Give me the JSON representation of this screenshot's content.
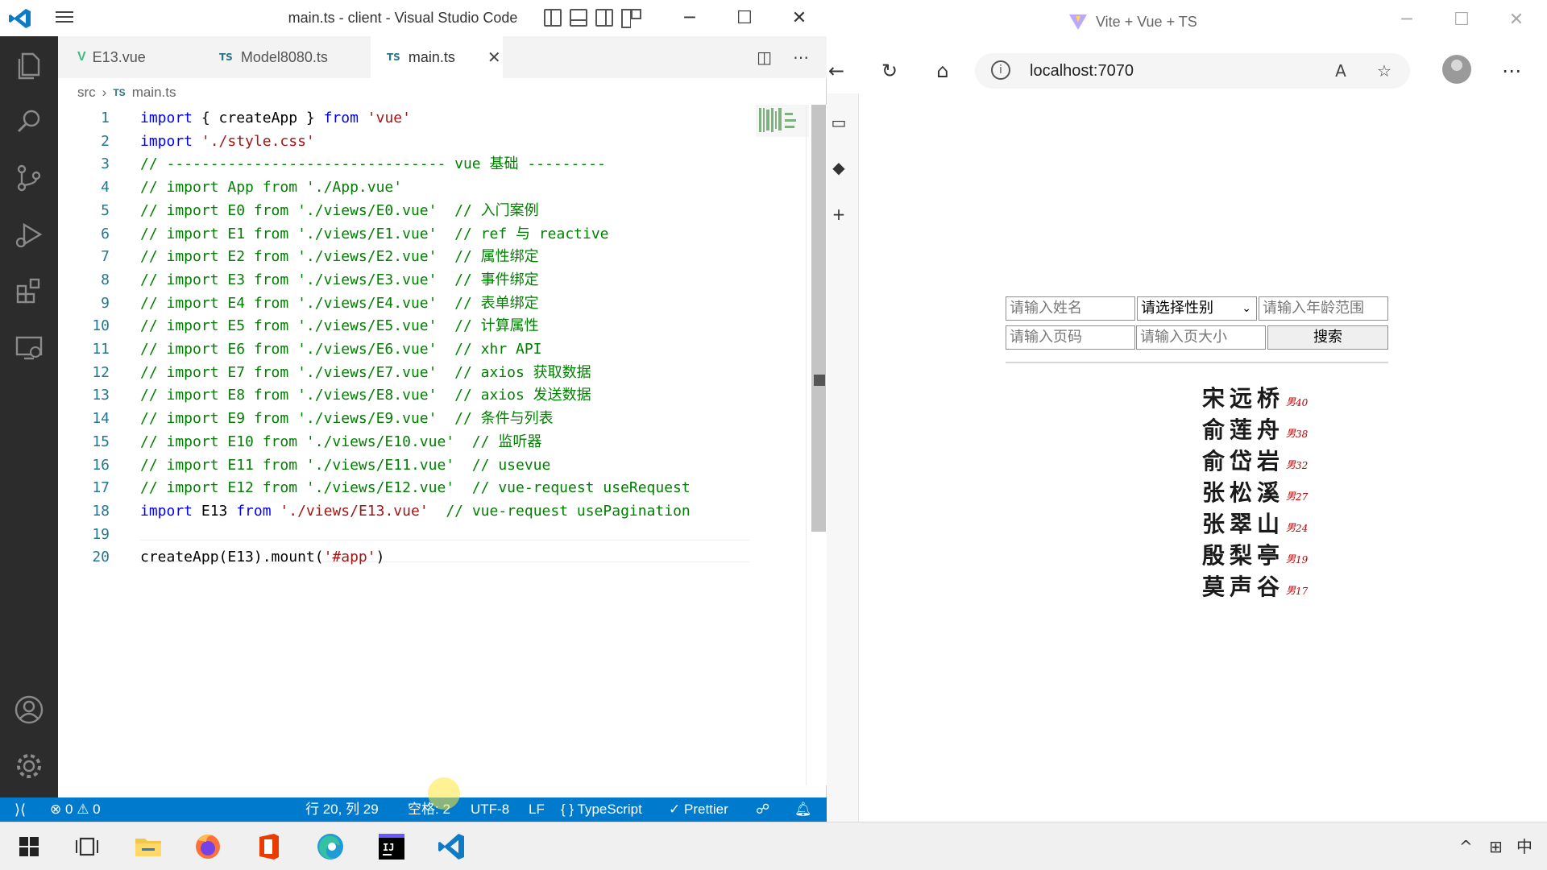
{
  "vscode": {
    "window_title": "main.ts - client - Visual Studio Code",
    "tabs": [
      {
        "badge": "V",
        "label": "E13.vue"
      },
      {
        "badge": "TS",
        "label": "Model8080.ts"
      },
      {
        "badge": "TS",
        "label": "main.ts",
        "close": "✕"
      }
    ],
    "breadcrumb": {
      "folder": "src",
      "badge": "TS",
      "file": "main.ts",
      "sep": "›"
    },
    "lines": [
      {
        "n": "1",
        "parts": [
          {
            "t": "import",
            "c": "kw"
          },
          {
            "t": " { createApp } ",
            "c": ""
          },
          {
            "t": "from",
            "c": "kw"
          },
          {
            "t": " ",
            "c": ""
          },
          {
            "t": "'vue'",
            "c": "str"
          }
        ]
      },
      {
        "n": "2",
        "parts": [
          {
            "t": "import",
            "c": "kw"
          },
          {
            "t": " ",
            "c": ""
          },
          {
            "t": "'./style.css'",
            "c": "str"
          }
        ]
      },
      {
        "n": "3",
        "comment": "// -------------------------------- vue 基础 ---------"
      },
      {
        "n": "4",
        "comment": "// import App from './App.vue'"
      },
      {
        "n": "5",
        "comment": "// import E0 from './views/E0.vue'  // 入门案例"
      },
      {
        "n": "6",
        "comment": "// import E1 from './views/E1.vue'  // ref 与 reactive"
      },
      {
        "n": "7",
        "comment": "// import E2 from './views/E2.vue'  // 属性绑定"
      },
      {
        "n": "8",
        "comment": "// import E3 from './views/E3.vue'  // 事件绑定"
      },
      {
        "n": "9",
        "comment": "// import E4 from './views/E4.vue'  // 表单绑定"
      },
      {
        "n": "10",
        "comment": "// import E5 from './views/E5.vue'  // 计算属性"
      },
      {
        "n": "11",
        "comment": "// import E6 from './views/E6.vue'  // xhr API"
      },
      {
        "n": "12",
        "comment": "// import E7 from './views/E7.vue'  // axios 获取数据"
      },
      {
        "n": "13",
        "comment": "// import E8 from './views/E8.vue'  // axios 发送数据"
      },
      {
        "n": "14",
        "comment": "// import E9 from './views/E9.vue'  // 条件与列表"
      },
      {
        "n": "15",
        "comment": "// import E10 from './views/E10.vue'  // 监听器"
      },
      {
        "n": "16",
        "comment": "// import E11 from './views/E11.vue'  // usevue"
      },
      {
        "n": "17",
        "comment": "// import E12 from './views/E12.vue'  // vue-request useRequest"
      },
      {
        "n": "18",
        "parts": [
          {
            "t": "import",
            "c": "kw"
          },
          {
            "t": " E13 ",
            "c": ""
          },
          {
            "t": "from",
            "c": "kw"
          },
          {
            "t": " ",
            "c": ""
          },
          {
            "t": "'./views/E13.vue'",
            "c": "str"
          },
          {
            "t": "  // vue-request usePagination",
            "c": "cm"
          }
        ]
      },
      {
        "n": "19",
        "parts": []
      },
      {
        "n": "20",
        "parts": [
          {
            "t": "createApp(E13).mount(",
            "c": ""
          },
          {
            "t": "'#app'",
            "c": "str"
          },
          {
            "t": ")",
            "c": ""
          }
        ]
      }
    ],
    "status": {
      "errors": "0",
      "warnings": "0",
      "position": "行 20, 列 29",
      "spaces": "空格: 2",
      "encoding": "UTF-8",
      "eol": "LF",
      "language_icon": "{ }",
      "language": "TypeScript",
      "prettier": "Prettier"
    }
  },
  "browser": {
    "title": "Vite + Vue + TS",
    "address": "localhost:7070",
    "form": {
      "name_placeholder": "请输入姓名",
      "gender_selected": "请选择性别",
      "age_placeholder": "请输入年龄范围",
      "page_placeholder": "请输入页码",
      "size_placeholder": "请输入页大小",
      "search_label": "搜索"
    },
    "people": [
      {
        "name": "宋远桥",
        "gender": "男",
        "age": "40"
      },
      {
        "name": "俞莲舟",
        "gender": "男",
        "age": "38"
      },
      {
        "name": "俞岱岩",
        "gender": "男",
        "age": "32"
      },
      {
        "name": "张松溪",
        "gender": "男",
        "age": "27"
      },
      {
        "name": "张翠山",
        "gender": "男",
        "age": "24"
      },
      {
        "name": "殷梨亭",
        "gender": "男",
        "age": "19"
      },
      {
        "name": "莫声谷",
        "gender": "男",
        "age": "17"
      }
    ]
  },
  "taskbar": {
    "ime": "中"
  },
  "colors": {
    "statusbar": "#007acc",
    "activitybar": "#2c2c2c",
    "keyword": "#0000ff",
    "string": "#a31515",
    "comment": "#008000"
  }
}
